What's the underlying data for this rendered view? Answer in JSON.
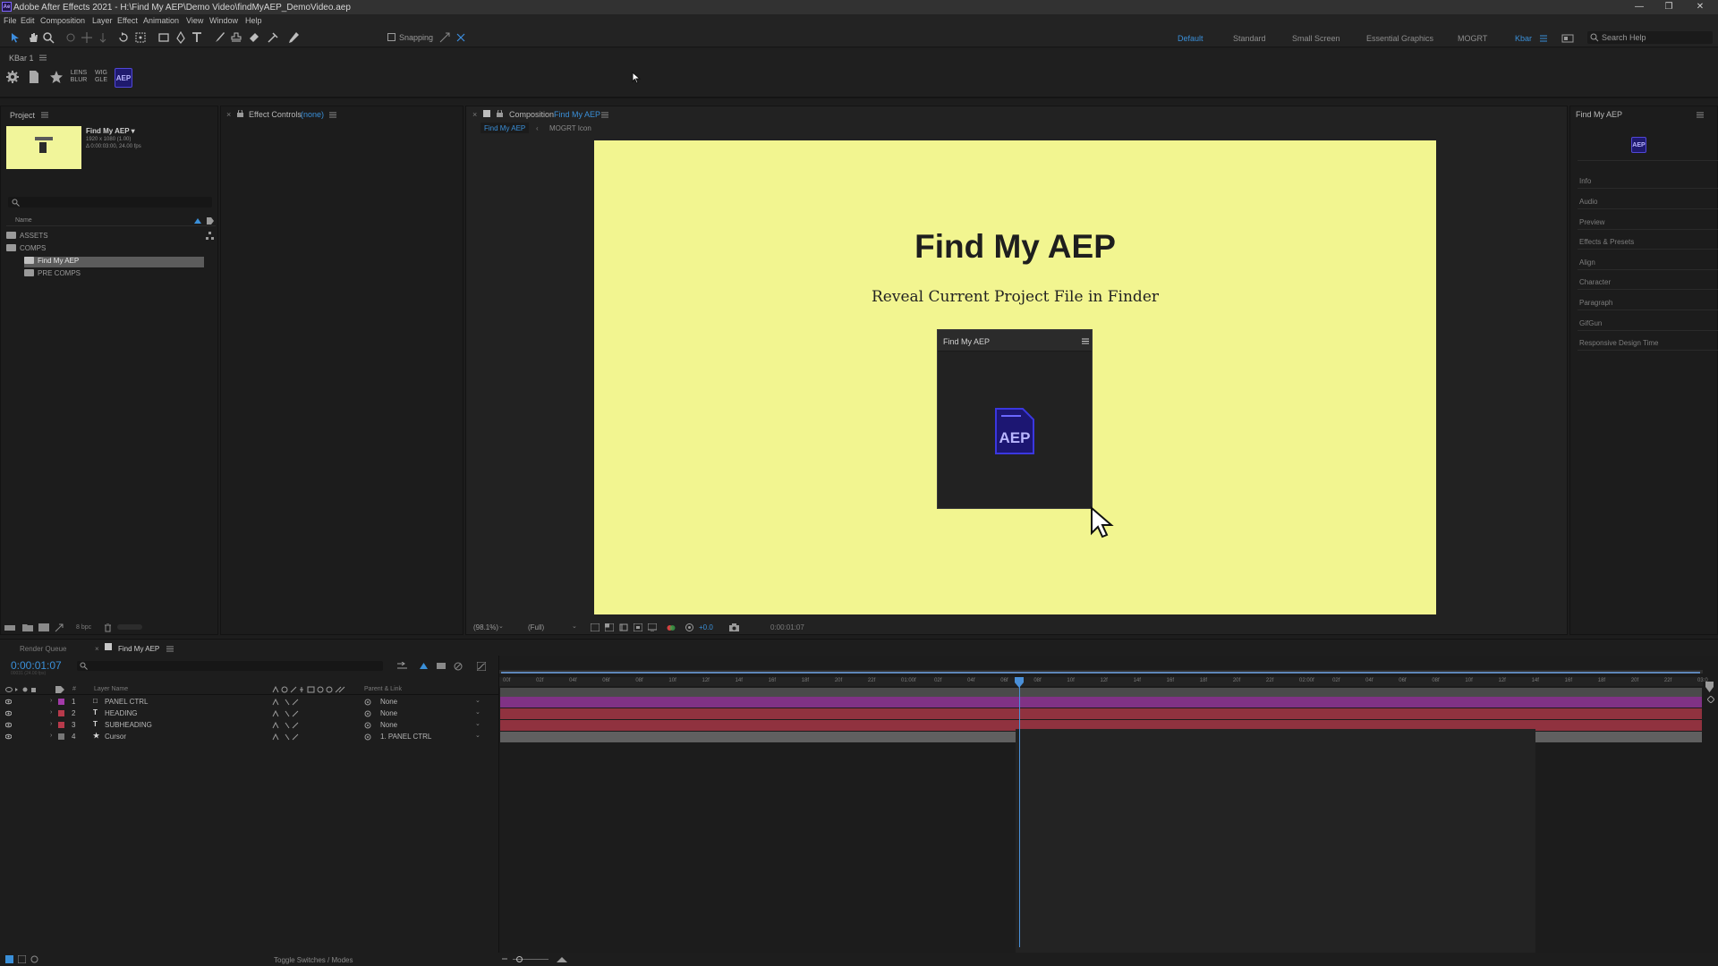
{
  "app": {
    "title": "Adobe After Effects 2021 - H:\\Find My AEP\\Demo Video\\findMyAEP_DemoVideo.aep",
    "logo_text": "Ae"
  },
  "menu": [
    "File",
    "Edit",
    "Composition",
    "Layer",
    "Effect",
    "Animation",
    "View",
    "Window",
    "Help"
  ],
  "toolbar": {
    "snapping_label": "Snapping",
    "workspaces": [
      "Default",
      "Standard",
      "Small Screen",
      "Essential Graphics",
      "MOGRT",
      "Kbar"
    ],
    "active_workspace": "Kbar",
    "search_placeholder": "Search Help"
  },
  "kbar": {
    "tab_label": "KBar 1",
    "buttons": [
      "gear-icon",
      "file-icon",
      "star-icon"
    ],
    "lens_blur": "LENS\nBLUR",
    "wiggle": "WIG\nGLE",
    "aep": "AEP"
  },
  "project": {
    "tab_label": "Project",
    "comp_name": "Find My AEP ▾",
    "comp_info_1": "1920 x 1080 (1.00)",
    "comp_info_2": "Δ 0:00:03:00, 24.00 fps",
    "search_placeholder": "",
    "column_name": "Name",
    "tree": [
      {
        "label": "ASSETS",
        "type": "folder"
      },
      {
        "label": "COMPS",
        "type": "folder"
      },
      {
        "label": "Find My AEP",
        "type": "comp",
        "selected": true
      },
      {
        "label": "PRE COMPS",
        "type": "folder"
      }
    ],
    "bpc": "8 bpc"
  },
  "effect_controls": {
    "tab_label": "Effect Controls",
    "target": "(none)"
  },
  "composition": {
    "tab_prefix": "Composition",
    "tab_name": "Find My AEP",
    "breadcrumbs": [
      "Find My AEP",
      "MOGRT Icon"
    ],
    "heading": "Find My AEP",
    "subheading": "Reveal Current Project File in Finder",
    "panel_title": "Find My AEP",
    "panel_icon_text": "AEP",
    "zoom": "(98.1%)",
    "resolution": "(Full)",
    "exposure": "+0.0",
    "timecode": "0:00:01:07",
    "background_color": "#f2f590"
  },
  "right_panel": {
    "title": "Find My AEP",
    "icon_text": "AEP",
    "items": [
      "Info",
      "Audio",
      "Preview",
      "Effects & Presets",
      "Align",
      "Character",
      "Paragraph",
      "GifGun",
      "Responsive Design Time"
    ]
  },
  "timeline": {
    "render_queue_tab": "Render Queue",
    "comp_tab": "Find My AEP",
    "timecode": "0:00:01:07",
    "timecode_sub": "00031 (24.00 fps)",
    "col_layer_name": "Layer Name",
    "col_parent": "Parent & Link",
    "layers": [
      {
        "num": "1",
        "name": "PANEL CTRL",
        "parent": "None",
        "type": "null",
        "color": "#a23aa8"
      },
      {
        "num": "2",
        "name": "HEADING",
        "parent": "None",
        "type": "text",
        "color": "#b73a4b"
      },
      {
        "num": "3",
        "name": "SUBHEADING",
        "parent": "None",
        "type": "text",
        "color": "#b73a4b"
      },
      {
        "num": "4",
        "name": "Cursor",
        "parent": "1. PANEL CTRL",
        "type": "shape",
        "color": "#777777"
      }
    ],
    "ruler": [
      "00f",
      "02f",
      "04f",
      "06f",
      "08f",
      "10f",
      "12f",
      "14f",
      "16f",
      "18f",
      "20f",
      "22f",
      "01:00f",
      "02f",
      "04f",
      "06f",
      "08f",
      "10f",
      "12f",
      "14f",
      "16f",
      "18f",
      "20f",
      "22f",
      "02:00f",
      "02f",
      "04f",
      "06f",
      "08f",
      "10f",
      "12f",
      "14f",
      "16f",
      "18f",
      "20f",
      "22f",
      "03:0"
    ],
    "playhead_fraction": 0.432,
    "toggle_label": "Toggle Switches / Modes"
  }
}
